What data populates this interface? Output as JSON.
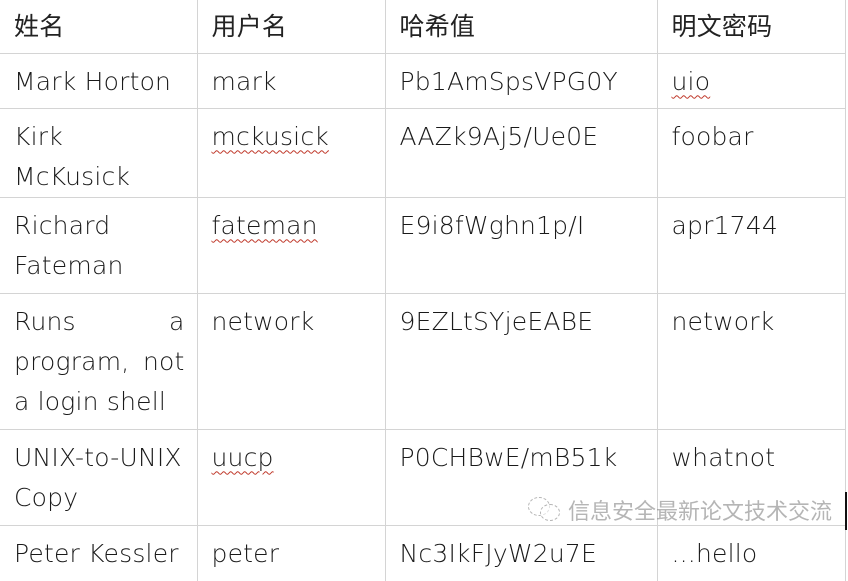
{
  "table": {
    "headers": [
      "姓名",
      "用户名",
      "哈希值",
      "明文密码"
    ],
    "rows": [
      {
        "name": "Mark Horton",
        "username": "mark",
        "hash": "Pb1AmSpsVPG0Y",
        "plaintext": "uio"
      },
      {
        "name": "Kirk McKusick",
        "username": "mckusick",
        "hash": "AAZk9Aj5/Ue0E",
        "plaintext": "foobar"
      },
      {
        "name": "Richard Fateman",
        "username": "fateman",
        "hash": "E9i8fWghn1p/I",
        "plaintext": "apr1744"
      },
      {
        "name": "Runs a program, not a login shell",
        "username": "network",
        "hash": "9EZLtSYjeEABE",
        "plaintext": "network"
      },
      {
        "name": "UNIX-to-UNIX Copy",
        "username": "uucp",
        "hash": "P0CHBwE/mB51k",
        "plaintext": "whatnot"
      },
      {
        "name": "Peter Kessler",
        "username": "peter",
        "hash": "Nc3IkFJyW2u7E",
        "plaintext": "...hello"
      }
    ]
  },
  "watermark": {
    "icon": "wechat-icon",
    "text": "信息安全最新论文技术交流"
  }
}
